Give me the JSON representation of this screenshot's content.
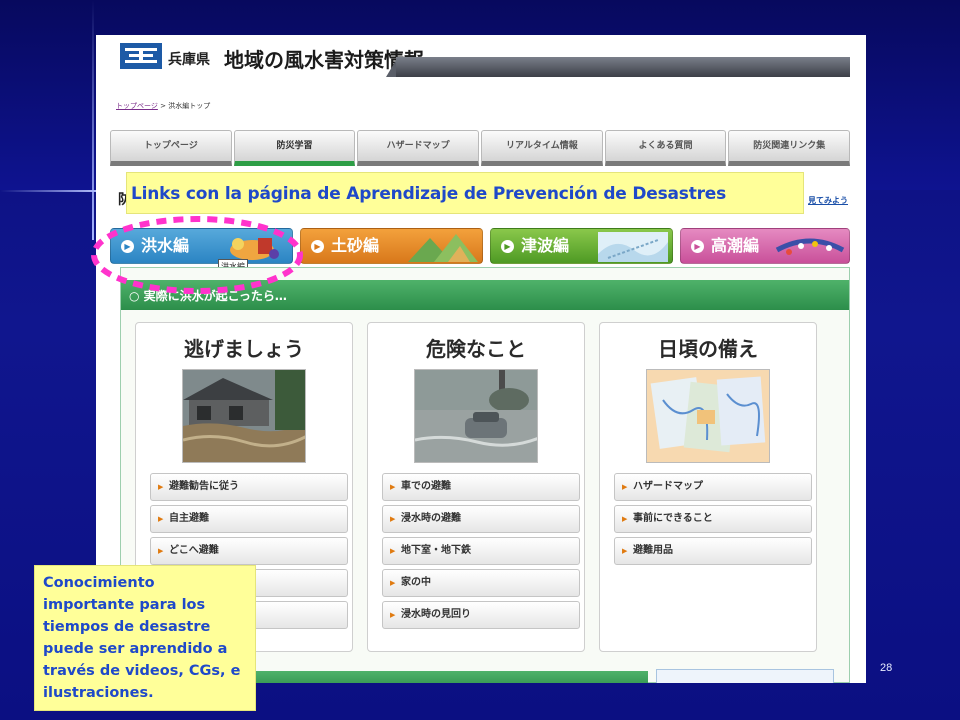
{
  "site": {
    "prefecture": "兵庫県",
    "title": "地域の風水害対策情報",
    "breadcrumb_home": "トップページ",
    "breadcrumb_sep": ">",
    "breadcrumb_current": "洪水編トップ"
  },
  "nav": {
    "tabs": [
      "トップページ",
      "防災学習",
      "ハザードマップ",
      "リアルタイム情報",
      "よくある質問",
      "防災関連リンク集"
    ],
    "active_index": 1
  },
  "intro": {
    "left_text": "防",
    "right_link": "見てみよう"
  },
  "categories": [
    {
      "label": "洪水編",
      "color": "#2b84c3"
    },
    {
      "label": "土砂編",
      "color": "#d8781b"
    },
    {
      "label": "津波編",
      "color": "#4e9a24"
    },
    {
      "label": "高潮編",
      "color": "#c9509a"
    }
  ],
  "tooltip": "洪水編",
  "section": {
    "title": "実際に洪水が起こったら…"
  },
  "columns": [
    {
      "heading": "逃げましょう",
      "photo": "flooded-house-photo",
      "links": [
        "避難勧告に従う",
        "自主避難",
        "どこへ避難",
        "",
        ""
      ]
    },
    {
      "heading": "危険なこと",
      "photo": "flooded-street-photo",
      "links": [
        "車での避難",
        "浸水時の避難",
        "地下室・地下鉄",
        "家の中",
        "浸水時の見回り"
      ]
    },
    {
      "heading": "日頃の備え",
      "photo": "hazard-map-photo",
      "links": [
        "ハザードマップ",
        "事前にできること",
        "避難用品"
      ]
    }
  ],
  "overlays": {
    "title_callout": "Links con la página de Aprendizaje de Prevención de Desastres",
    "bottom_callout": "Conocimiento importante para los tiempos de desastre puede ser aprendido a través de videos, CGs, e ilustraciones.",
    "highlight_color": "#ff33cc",
    "callout_bg": "#ffff99",
    "callout_text_color": "#1f49c9"
  },
  "slide_number": "28"
}
